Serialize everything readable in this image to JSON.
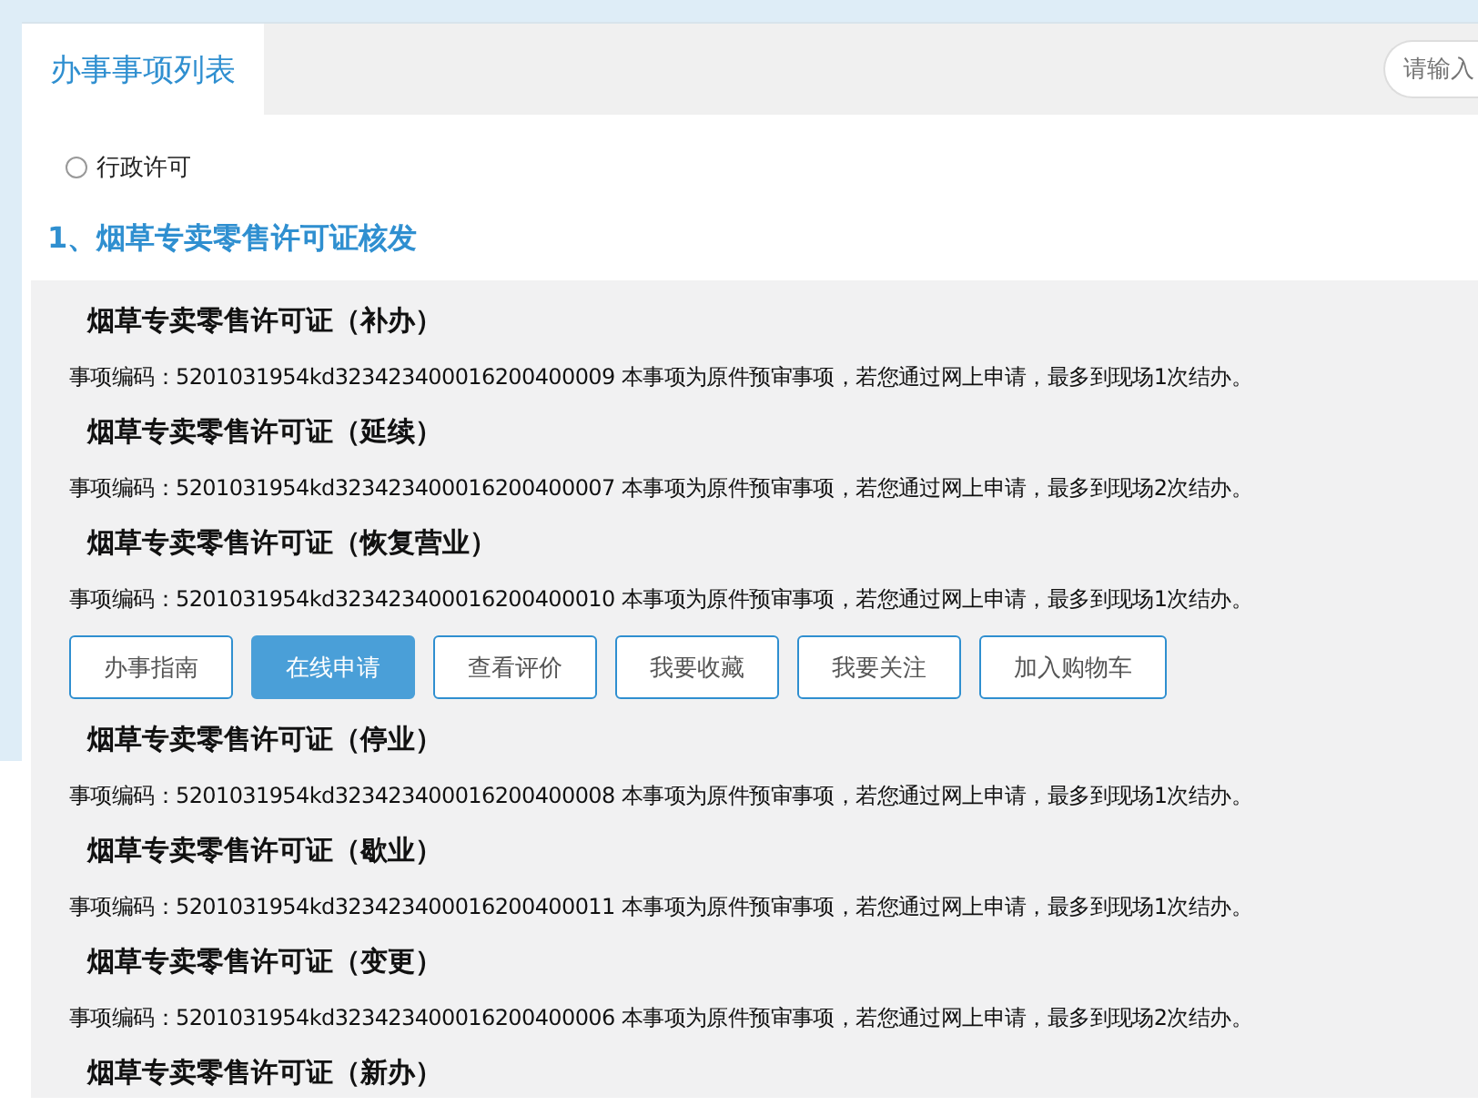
{
  "tabs": [
    {
      "label": "办事事项列表",
      "selected": true
    }
  ],
  "search": {
    "placeholder": "请输入"
  },
  "category": {
    "label": "行政许可",
    "checked": false
  },
  "section_title": "1、烟草专卖零售许可证核发",
  "items": [
    {
      "title": "烟草专卖零售许可证（补办）",
      "code": "事项编码：5201031954kd323423400016200400009 本事项为原件预审事项，若您通过网上申请，最多到现场1次结办。",
      "expanded": false
    },
    {
      "title": "烟草专卖零售许可证（延续）",
      "code": "事项编码：5201031954kd323423400016200400007 本事项为原件预审事项，若您通过网上申请，最多到现场2次结办。",
      "expanded": false
    },
    {
      "title": "烟草专卖零售许可证（恢复营业）",
      "code": "事项编码：5201031954kd323423400016200400010 本事项为原件预审事项，若您通过网上申请，最多到现场1次结办。",
      "expanded": true
    },
    {
      "title": "烟草专卖零售许可证（停业）",
      "code": "事项编码：5201031954kd323423400016200400008 本事项为原件预审事项，若您通过网上申请，最多到现场1次结办。",
      "expanded": false
    },
    {
      "title": "烟草专卖零售许可证（歇业）",
      "code": "事项编码：5201031954kd323423400016200400011 本事项为原件预审事项，若您通过网上申请，最多到现场1次结办。",
      "expanded": false
    },
    {
      "title": "烟草专卖零售许可证（变更）",
      "code": "事项编码：5201031954kd323423400016200400006 本事项为原件预审事项，若您通过网上申请，最多到现场2次结办。",
      "expanded": false
    },
    {
      "title": "烟草专卖零售许可证（新办）",
      "expanded": false
    }
  ],
  "actions": [
    {
      "label": "办事指南",
      "selected": false
    },
    {
      "label": "在线申请",
      "selected": true
    },
    {
      "label": "查看评价",
      "selected": false
    },
    {
      "label": "我要收藏",
      "selected": false
    },
    {
      "label": "我要关注",
      "selected": false
    },
    {
      "label": "加入购物车",
      "selected": false
    }
  ]
}
